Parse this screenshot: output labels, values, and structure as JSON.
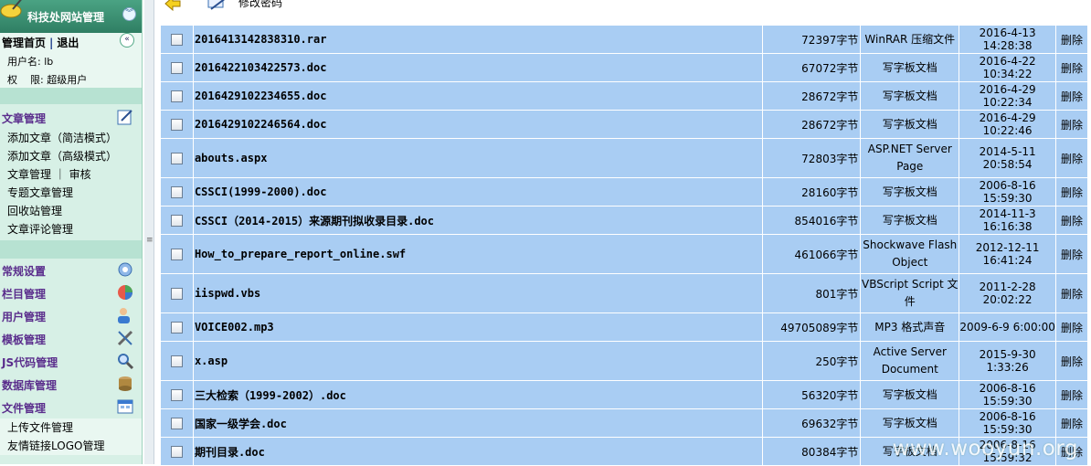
{
  "sidebar": {
    "title": "科技处网站管理",
    "home_link": "管理首页",
    "separator": "|",
    "logout_link": "退出",
    "username_label": "用户名:",
    "username_value": "lb",
    "role_label": "权    限:",
    "role_value": "超级用户",
    "groups": [
      {
        "label": "文章管理",
        "icon": "edit-icon",
        "items": [
          "添加文章（简洁模式）",
          "添加文章（高级模式）",
          "文章管理 ｜ 审核",
          "专题文章管理",
          "回收站管理",
          "文章评论管理"
        ]
      },
      {
        "label": "常规设置",
        "icon": "settings-icon",
        "items": []
      },
      {
        "label": "栏目管理",
        "icon": "column-icon",
        "items": []
      },
      {
        "label": "用户管理",
        "icon": "users-icon",
        "items": []
      },
      {
        "label": "模板管理",
        "icon": "template-icon",
        "items": []
      },
      {
        "label": "JS代码管理",
        "icon": "js-search-icon",
        "items": []
      },
      {
        "label": "数据库管理",
        "icon": "database-icon",
        "items": []
      },
      {
        "label": "文件管理",
        "icon": "file-icon",
        "items": [
          "上传文件管理",
          "友情链接LOGO管理"
        ]
      }
    ]
  },
  "toolbar": {
    "change_password_label": "修改密码"
  },
  "files": [
    {
      "name": "2016413142838310.rar",
      "size": "72397字节",
      "type": "WinRAR 压缩文件",
      "time": "2016-4-13 14:28:38",
      "action": "删除"
    },
    {
      "name": "2016422103422573.doc",
      "size": "67072字节",
      "type": "写字板文档",
      "time": "2016-4-22 10:34:22",
      "action": "删除"
    },
    {
      "name": "2016429102234655.doc",
      "size": "28672字节",
      "type": "写字板文档",
      "time": "2016-4-29 10:22:34",
      "action": "删除"
    },
    {
      "name": "2016429102246564.doc",
      "size": "28672字节",
      "type": "写字板文档",
      "time": "2016-4-29 10:22:46",
      "action": "删除"
    },
    {
      "name": "abouts.aspx",
      "size": "72803字节",
      "type": "ASP.NET Server Page",
      "time": "2014-5-11 20:58:54",
      "action": "删除"
    },
    {
      "name": "CSSCI(1999-2000).doc",
      "size": "28160字节",
      "type": "写字板文档",
      "time": "2006-8-16 15:59:30",
      "action": "删除"
    },
    {
      "name": "CSSCI（2014-2015）来源期刊拟收录目录.doc",
      "size": "854016字节",
      "type": "写字板文档",
      "time": "2014-11-3 16:16:38",
      "action": "删除"
    },
    {
      "name": "How_to_prepare_report_online.swf",
      "size": "461066字节",
      "type": "Shockwave Flash Object",
      "time": "2012-12-11 16:41:24",
      "action": "删除"
    },
    {
      "name": "iispwd.vbs",
      "size": "801字节",
      "type": "VBScript Script 文件",
      "time": "2011-2-28 20:02:22",
      "action": "删除"
    },
    {
      "name": "VOICE002.mp3",
      "size": "49705089字节",
      "type": "MP3 格式声音",
      "time": "2009-6-9 6:00:00",
      "action": "删除"
    },
    {
      "name": "x.asp",
      "size": "250字节",
      "type": "Active Server Document",
      "time": "2015-9-30 1:33:26",
      "action": "删除"
    },
    {
      "name": "三大检索（1999-2002）.doc",
      "size": "56320字节",
      "type": "写字板文档",
      "time": "2006-8-16 15:59:30",
      "action": "删除"
    },
    {
      "name": "国家一级学会.doc",
      "size": "69632字节",
      "type": "写字板文档",
      "time": "2006-8-16 15:59:30",
      "action": "删除"
    },
    {
      "name": "期刊目录.doc",
      "size": "80384字节",
      "type": "写字板文档",
      "time": "2006-8-16 15:59:32",
      "action": "删除"
    }
  ],
  "watermark": "www.wooyun.org",
  "colors": {
    "row_bg": "#a9cdf3",
    "sidebar_bg": "#d7f0e6",
    "group_label": "#5a2d8c"
  }
}
